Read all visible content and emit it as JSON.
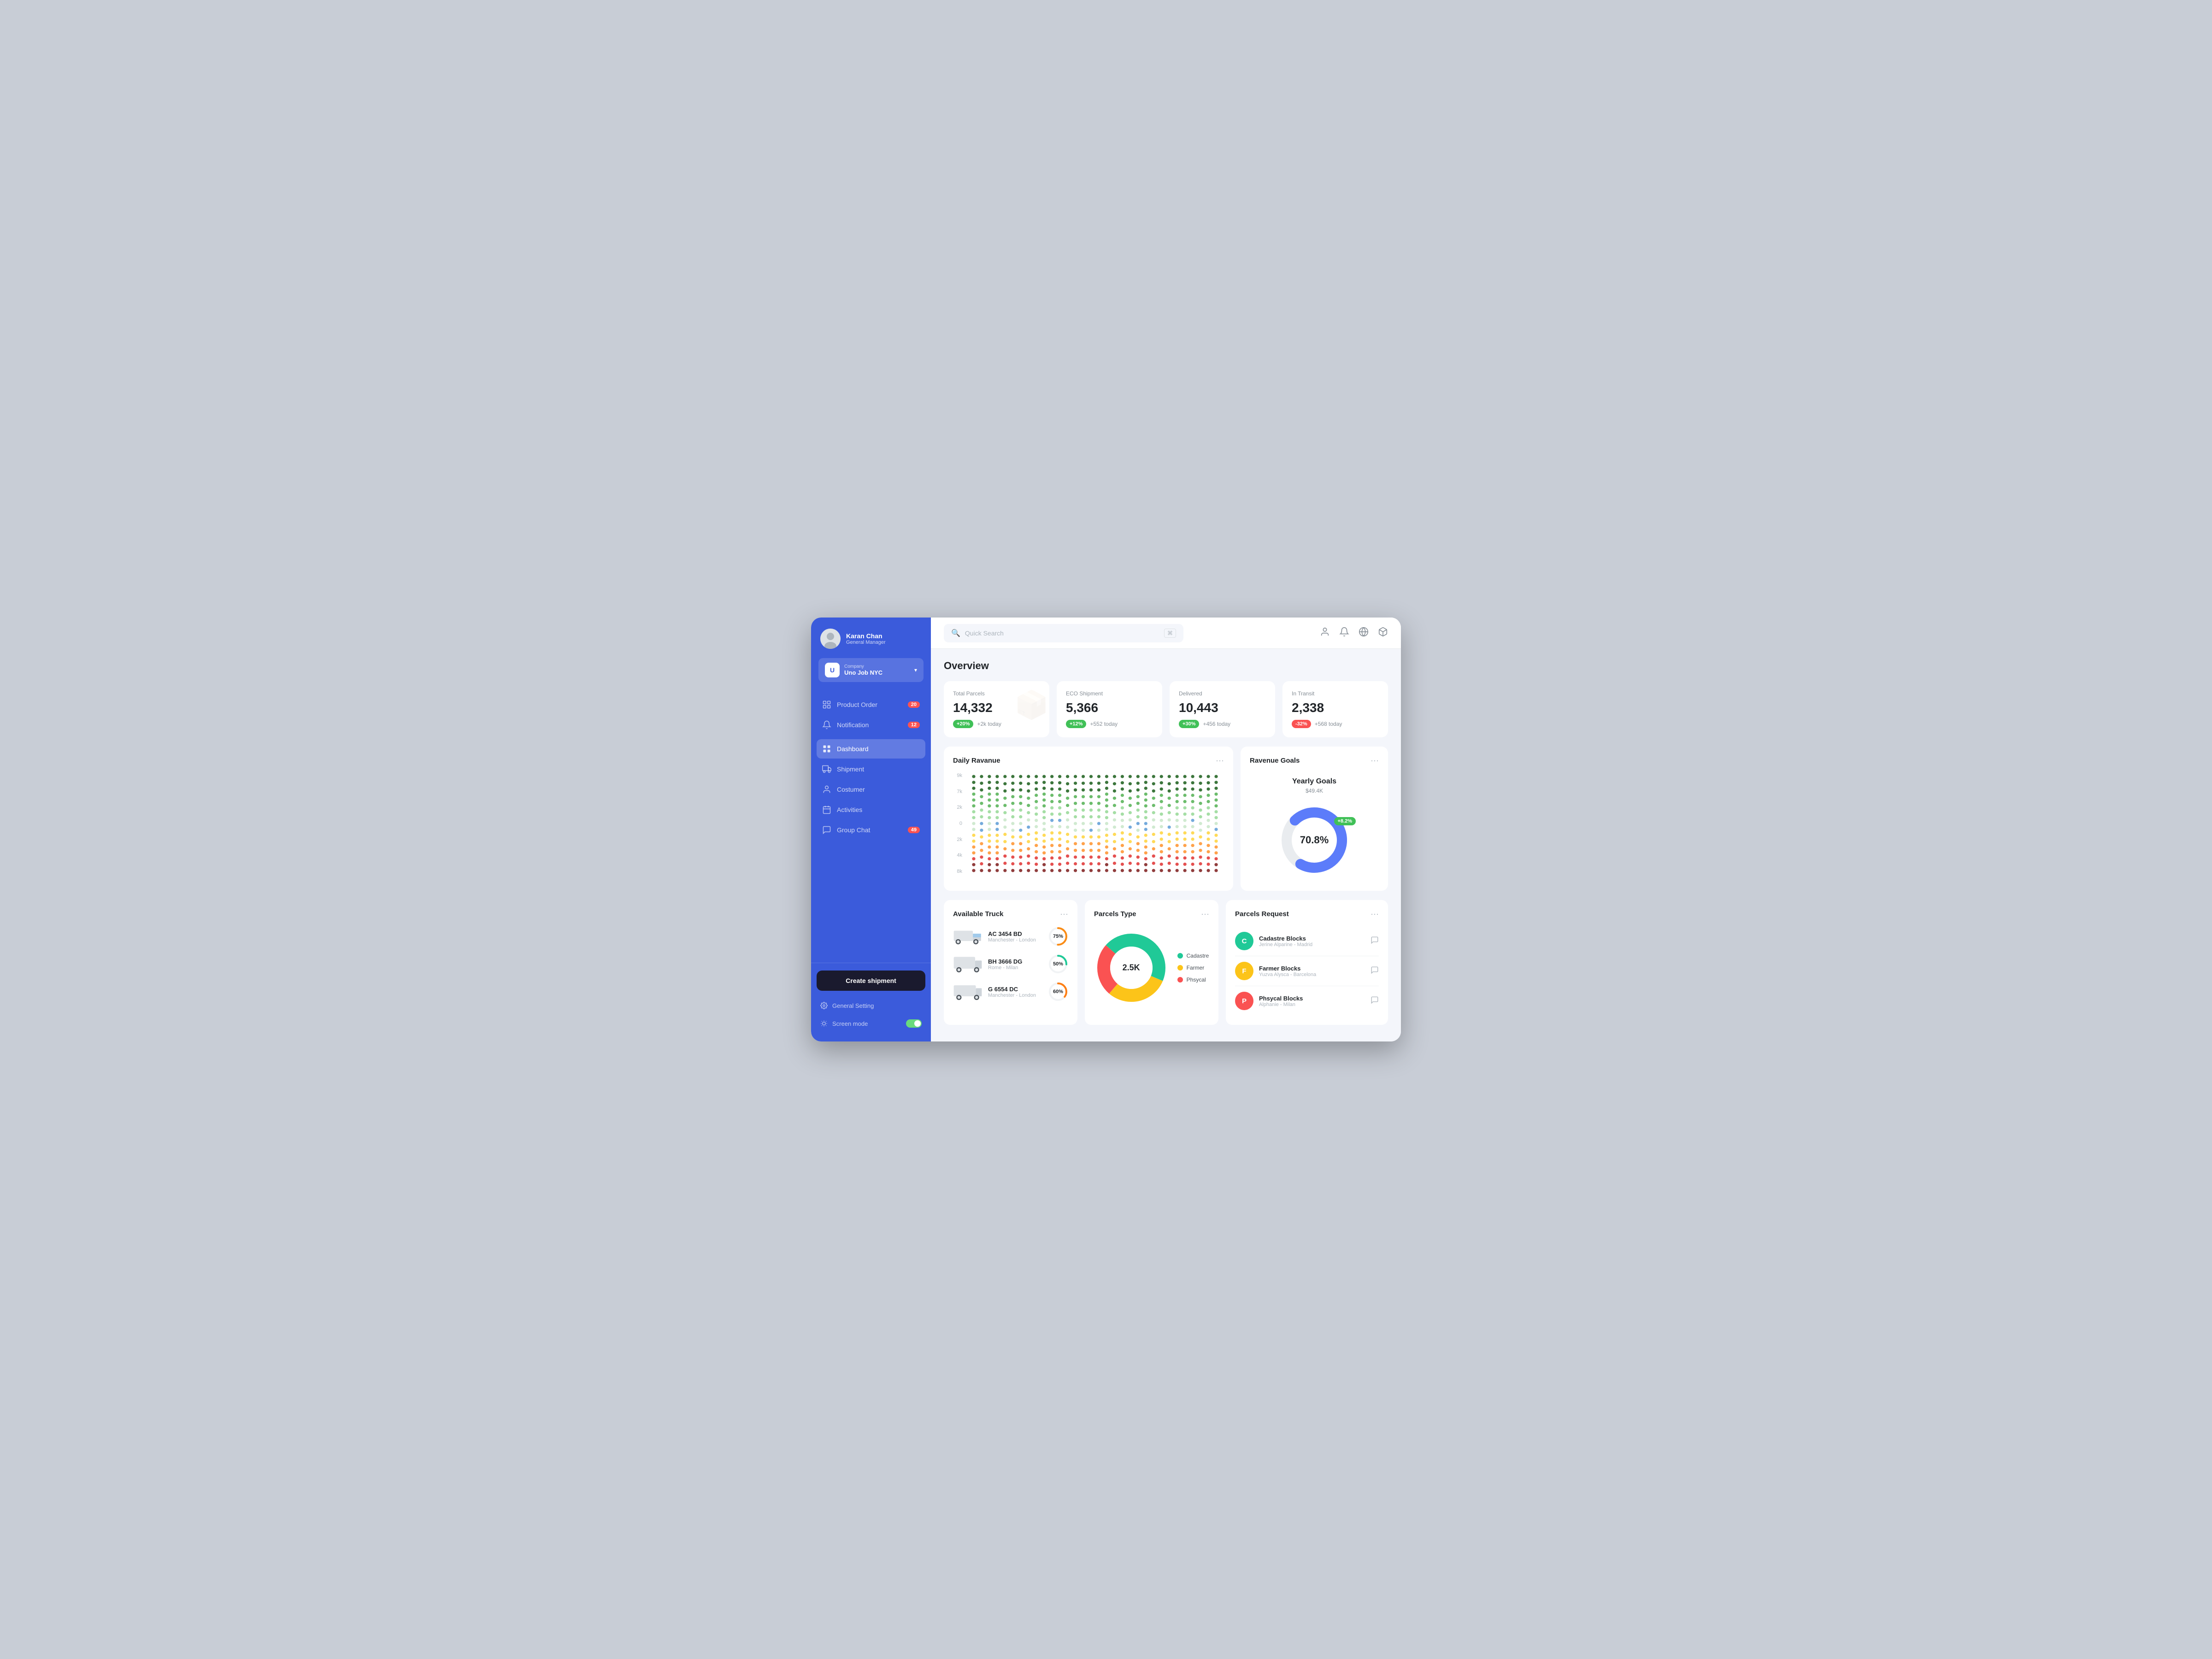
{
  "sidebar": {
    "user": {
      "name": "Karan Chan",
      "role": "General Manager"
    },
    "company": {
      "initial": "U",
      "label": "Company",
      "name": "Uno Job NYC"
    },
    "nav": [
      {
        "id": "product-order",
        "label": "Product Order",
        "badge": "20",
        "active": false
      },
      {
        "id": "notification",
        "label": "Notification",
        "badge": "12",
        "active": false
      },
      {
        "id": "dashboard",
        "label": "Dashboard",
        "badge": null,
        "active": true
      },
      {
        "id": "shipment",
        "label": "Shipment",
        "badge": null,
        "active": false
      },
      {
        "id": "costumer",
        "label": "Costumer",
        "badge": null,
        "active": false
      },
      {
        "id": "activities",
        "label": "Activities",
        "badge": null,
        "active": false
      },
      {
        "id": "group-chat",
        "label": "Group Chat",
        "badge": "49",
        "active": false
      }
    ],
    "create_shipment": "Create shipment",
    "general_setting": "General Setting",
    "screen_mode": "Screen mode"
  },
  "topbar": {
    "search_placeholder": "Quick Search",
    "shortcut": "⌘"
  },
  "page": {
    "title": "Overview"
  },
  "stats": [
    {
      "label": "Total Parcels",
      "value": "14,332",
      "badge": "+20%",
      "badge_type": "green",
      "today": "+2k today"
    },
    {
      "label": "ECO Shipment",
      "value": "5,366",
      "badge": "+12%",
      "badge_type": "green",
      "today": "+552 today"
    },
    {
      "label": "Delivered",
      "value": "10,443",
      "badge": "+30%",
      "badge_type": "green",
      "today": "+456 today"
    },
    {
      "label": "In Transit",
      "value": "2,338",
      "badge": "-32%",
      "badge_type": "red",
      "today": "+568 today"
    }
  ],
  "daily_revenue": {
    "title": "Daily Ravanue",
    "y_labels": [
      "9k",
      "7k",
      "2k",
      "0",
      "2k",
      "4k",
      "8k"
    ]
  },
  "revenue_goals": {
    "title": "Ravenue Goals",
    "donut_title": "Yearly Goals",
    "donut_subtitle": "$49.4K",
    "value": "70.8%",
    "badge": "+8.2%",
    "progress": 70.8
  },
  "available_truck": {
    "title": "Available Truck",
    "trucks": [
      {
        "id": "AC 3454 BD",
        "route": "Manchester - London",
        "progress": 75,
        "color": "#fa8c16"
      },
      {
        "id": "BH 3666 DG",
        "route": "Rome - Milan",
        "progress": 50,
        "color": "#20c997"
      },
      {
        "id": "G 6554 DC",
        "route": "Manchester - London",
        "progress": 60,
        "color": "#fd7e14"
      }
    ]
  },
  "parcels_type": {
    "title": "Parcels Type",
    "center": "2.5K",
    "segments": [
      {
        "label": "Cadastre",
        "color": "#20c997",
        "percent": 45
      },
      {
        "label": "Farmer",
        "color": "#fcc419",
        "percent": 30
      },
      {
        "label": "Phsycal",
        "color": "#fa5252",
        "percent": 25
      }
    ]
  },
  "parcels_request": {
    "title": "Parcels Request",
    "items": [
      {
        "initial": "C",
        "color": "#20c997",
        "name": "Cadastre Blocks",
        "sub": "Jerine Alparine - Madrid"
      },
      {
        "initial": "F",
        "color": "#fcc419",
        "name": "Farmer Blocks",
        "sub": "Yuzva Alysca - Barcelona"
      },
      {
        "initial": "P",
        "color": "#fa5252",
        "name": "Phsycal Blocks",
        "sub": "Alphanie - Milan"
      }
    ]
  }
}
